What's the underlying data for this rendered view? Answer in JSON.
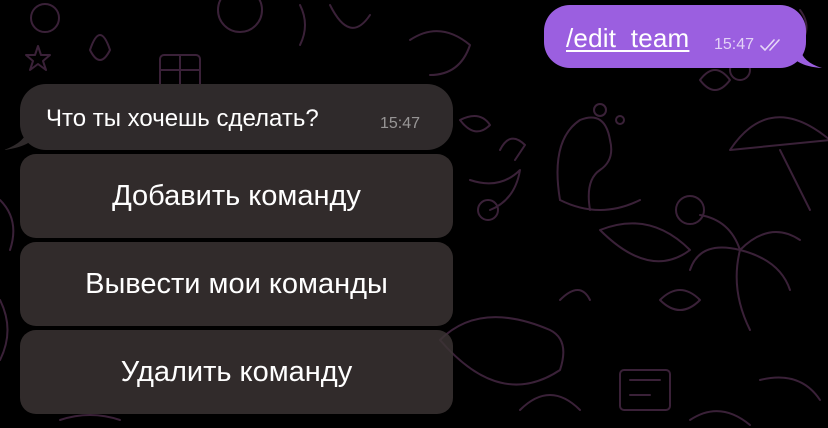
{
  "outgoing_message": {
    "text": "/edit_team",
    "time": "15:47",
    "status_icon": "double-check-icon"
  },
  "incoming_message": {
    "text": "Что ты хочешь сделать?",
    "time": "15:47"
  },
  "inline_keyboard": {
    "buttons": [
      {
        "label": "Добавить команду"
      },
      {
        "label": "Вывести мои команды"
      },
      {
        "label": "Удалить команду"
      }
    ]
  },
  "colors": {
    "background": "#000000",
    "wallpaper_doodle": "#3a2138",
    "outgoing_bubble": "#9b5fe0",
    "incoming_bubble": "#2f2a2b",
    "keyboard_button": "#3c3435"
  }
}
